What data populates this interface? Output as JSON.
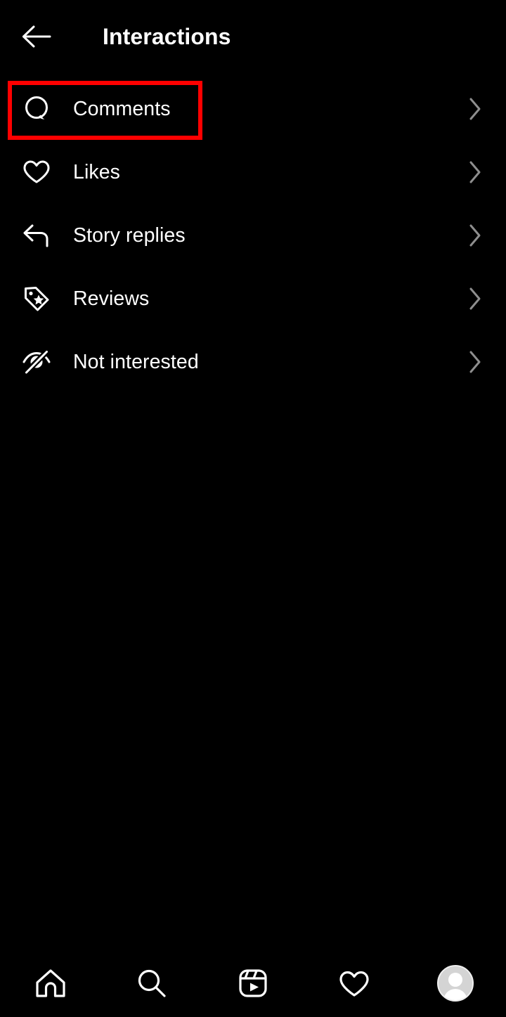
{
  "header": {
    "title": "Interactions",
    "back_icon": "arrow-left-icon"
  },
  "colors": {
    "background": "#000000",
    "text": "#ffffff",
    "chevron": "#8e8e8e",
    "highlight": "#fe0000",
    "avatar_fill": "#d4d4d4"
  },
  "list": {
    "items": [
      {
        "label": "Comments",
        "icon": "comment-bubble-icon",
        "chevron": "chevron-right-icon",
        "highlighted": true
      },
      {
        "label": "Likes",
        "icon": "heart-icon",
        "chevron": "chevron-right-icon",
        "highlighted": false
      },
      {
        "label": "Story replies",
        "icon": "reply-arrow-icon",
        "chevron": "chevron-right-icon",
        "highlighted": false
      },
      {
        "label": "Reviews",
        "icon": "tag-star-icon",
        "chevron": "chevron-right-icon",
        "highlighted": false
      },
      {
        "label": "Not interested",
        "icon": "eye-slash-icon",
        "chevron": "chevron-right-icon",
        "highlighted": false
      }
    ]
  },
  "bottom_nav": {
    "items": [
      {
        "name": "home",
        "icon": "home-icon"
      },
      {
        "name": "search",
        "icon": "search-icon"
      },
      {
        "name": "reels",
        "icon": "reels-icon"
      },
      {
        "name": "likes",
        "icon": "heart-icon"
      },
      {
        "name": "profile",
        "icon": "avatar-icon"
      }
    ]
  }
}
